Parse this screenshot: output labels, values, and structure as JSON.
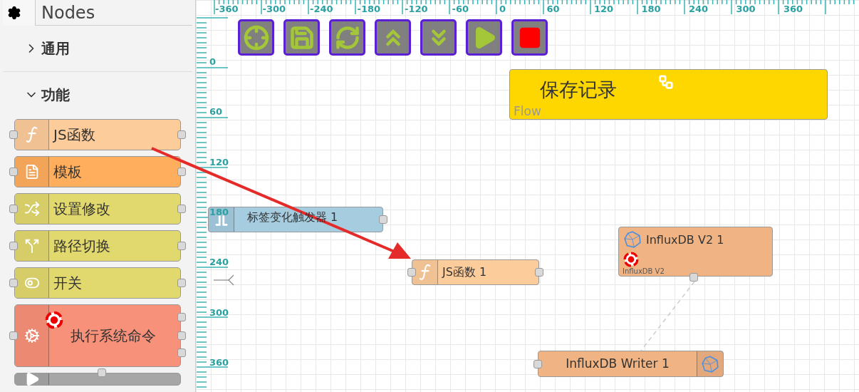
{
  "sidebar": {
    "title": "Nodes",
    "categories": [
      {
        "label": "通用",
        "expanded": false
      },
      {
        "label": "功能",
        "expanded": true,
        "nodes": [
          {
            "label": "JS函数",
            "kind": "function",
            "color": "#fdcc9b",
            "alert": false
          },
          {
            "label": "模板",
            "kind": "template",
            "color": "#ffae5e",
            "alert": false
          },
          {
            "label": "设置修改",
            "kind": "change",
            "color": "#e2d96e",
            "alert": false
          },
          {
            "label": "路径切换",
            "kind": "switch",
            "color": "#e2d96e",
            "alert": false
          },
          {
            "label": "开关",
            "kind": "toggle",
            "color": "#e2d96e",
            "alert": false
          },
          {
            "label": "执行系统命令",
            "kind": "exec",
            "color": "#f8917a",
            "alert": true
          },
          {
            "kind": "play",
            "color": "#a6a6a6",
            "alert": false
          }
        ]
      }
    ]
  },
  "ruler": {
    "x_labels": [
      "-360",
      "-300",
      "-240",
      "-180",
      "-120",
      "-60",
      "0",
      "60",
      "120",
      "180",
      "240",
      "300",
      "360"
    ],
    "y_labels": [
      "0",
      "60",
      "120",
      "180",
      "240",
      "300",
      "360"
    ]
  },
  "toolbar": [
    {
      "kind": "locate"
    },
    {
      "kind": "save"
    },
    {
      "kind": "refresh"
    },
    {
      "kind": "up"
    },
    {
      "kind": "down"
    },
    {
      "kind": "play"
    },
    {
      "kind": "stop"
    }
  ],
  "canvas": {
    "nodes": [
      {
        "kind": "comment",
        "label": "保存记录",
        "sublabel": "Flow",
        "color": "#ffd700"
      },
      {
        "kind": "trigger",
        "label": "标签变化触发器 1",
        "color": "#a6cce0",
        "alert": false
      },
      {
        "kind": "function",
        "label": "JS函数 1",
        "color": "#fdcc9b",
        "alert": false
      },
      {
        "kind": "influx-config",
        "label": "InfluxDB V2 1",
        "sublabel": "InfluxDB V2",
        "color": "#f0b383",
        "alert": true
      },
      {
        "kind": "influx-writer",
        "label": "InfluxDB Writer 1",
        "color": "#f0b383",
        "alert": false
      }
    ]
  }
}
